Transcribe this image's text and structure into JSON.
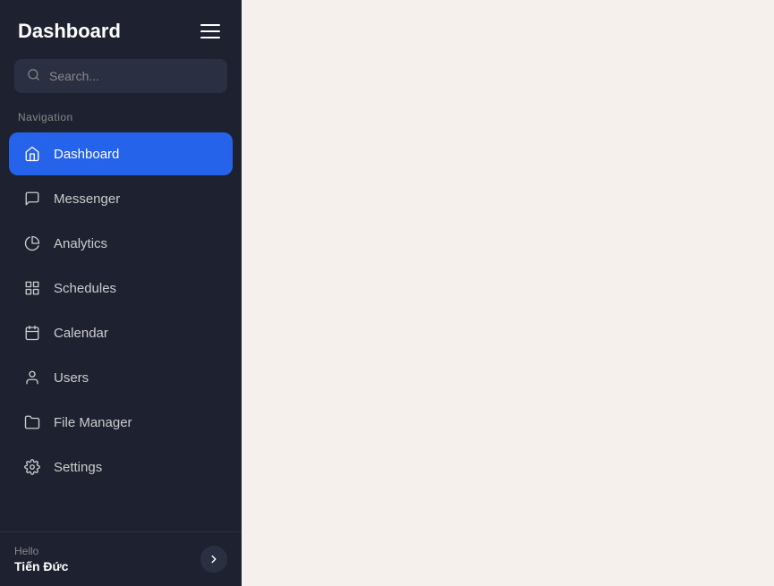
{
  "sidebar": {
    "title": "Dashboard",
    "search": {
      "placeholder": "Search..."
    },
    "nav_label": "Navigation",
    "items": [
      {
        "id": "dashboard",
        "label": "Dashboard",
        "icon": "home",
        "active": true
      },
      {
        "id": "messenger",
        "label": "Messenger",
        "icon": "message-circle",
        "active": false
      },
      {
        "id": "analytics",
        "label": "Analytics",
        "icon": "pie-chart",
        "active": false
      },
      {
        "id": "schedules",
        "label": "Schedules",
        "icon": "grid",
        "active": false
      },
      {
        "id": "calendar",
        "label": "Calendar",
        "icon": "calendar",
        "active": false
      },
      {
        "id": "users",
        "label": "Users",
        "icon": "user-circle",
        "active": false
      },
      {
        "id": "file-manager",
        "label": "File Manager",
        "icon": "folder",
        "active": false
      },
      {
        "id": "settings",
        "label": "Settings",
        "icon": "settings",
        "active": false
      }
    ],
    "user": {
      "hello_label": "Hello",
      "name": "Tiến Đức"
    }
  }
}
